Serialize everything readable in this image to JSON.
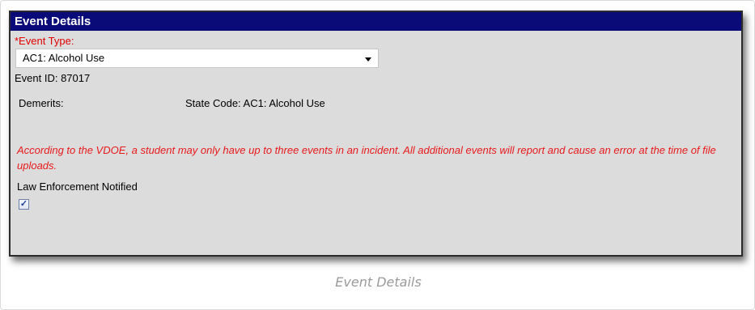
{
  "panel": {
    "title": "Event Details"
  },
  "event_type": {
    "label": "*Event Type:",
    "selected": "AC1: Alcohol Use",
    "icon": "chevron-down-icon"
  },
  "event_id": {
    "text": "Event ID: 87017"
  },
  "demerits": {
    "label": "Demerits:"
  },
  "state_code": {
    "text": "State Code: AC1: Alcohol Use"
  },
  "warning": {
    "text": "According to the VDOE, a student may only have up to three events in an incident. All additional events will report and cause an error at the time of file uploads."
  },
  "law_enforcement": {
    "label": "Law Enforcement Notified",
    "checked": true,
    "check_glyph": "✓"
  },
  "caption": {
    "text": "Event Details"
  },
  "colors": {
    "header_bg": "#0a0a78",
    "panel_bg": "#dcdcdc",
    "required_red": "#e00000",
    "warning_red": "#e8191b"
  }
}
